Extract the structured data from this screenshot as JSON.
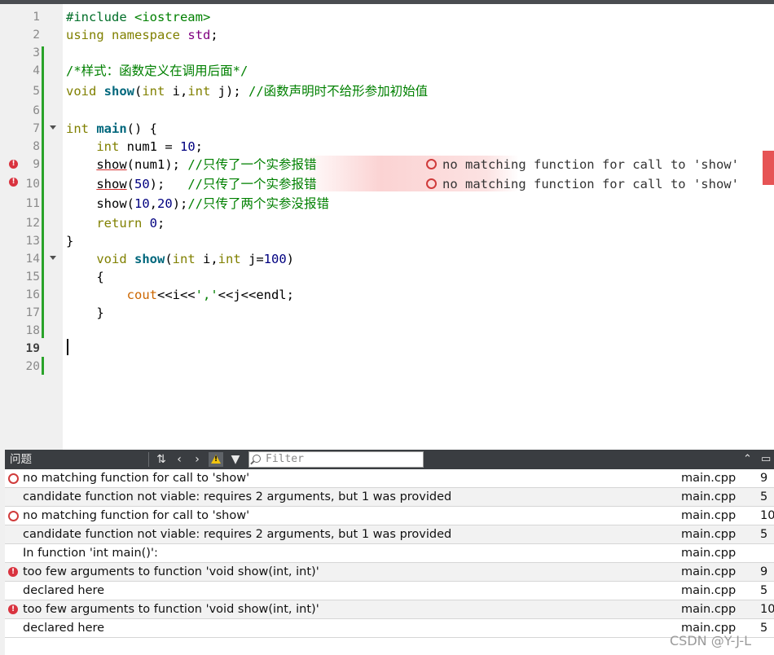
{
  "editor": {
    "line_numbers": [
      "1",
      "2",
      "3",
      "4",
      "5",
      "6",
      "7",
      "8",
      "9",
      "10",
      "11",
      "12",
      "13",
      "14",
      "15",
      "16",
      "17",
      "18",
      "19",
      "20"
    ],
    "current_line": "19",
    "lines": {
      "l1a": "#include",
      "l1b": " <iostream>",
      "l2a": "using",
      "l2b": "namespace",
      "l2c": "std",
      "l4": "/*样式：函数定义在调用后面*/",
      "l5a": "void",
      "l5b": "show",
      "l5c": "(",
      "l5d": "int",
      "l5e": " i,",
      "l5f": "int",
      "l5g": " j); ",
      "l5h": "//函数声明时不给形参加初始值",
      "l7a": "int",
      "l7b": "main",
      "l7c": "() {",
      "l8a": "int",
      "l8b": " num1 = ",
      "l8c": "10",
      "l8d": ";",
      "l9a": "show",
      "l9b": "(num1); ",
      "l9c": "//只传了一个实参报错",
      "l10a": "show",
      "l10b": "(",
      "l10c": "50",
      "l10d": ");   ",
      "l10e": "//只传了一个实参报错",
      "l11a": "show",
      "l11b": "(",
      "l11c": "10",
      "l11d": ",",
      "l11e": "20",
      "l11f": ");",
      "l11g": "//只传了两个实参没报错",
      "l12a": "return",
      "l12b": " ",
      "l12c": "0",
      "l12d": ";",
      "l13": "}",
      "l14a": "void",
      "l14b": "show",
      "l14c": "(",
      "l14d": "int",
      "l14e": " i,",
      "l14f": "int",
      "l14g": " j=",
      "l14h": "100",
      "l14i": ")",
      "l15": "{",
      "l16a": "cout",
      "l16b": "<<i<<",
      "l16c": "','",
      "l16d": "<<j<<endl;",
      "l17": "}"
    },
    "inline_errors": {
      "line9": "no matching function for call to 'show'",
      "line10": "no matching function for call to 'show'"
    }
  },
  "panel": {
    "title": "问题",
    "filter_placeholder": "Filter",
    "icons": [
      "filter-sort-icon",
      "prev-arrow-icon",
      "next-arrow-icon",
      "warning-icon",
      "funnel-icon",
      "search-icon",
      "collapse-up-icon",
      "maximize-icon"
    ],
    "issues": [
      {
        "type": "error-ring",
        "message": "no matching function for call to 'show'",
        "file": "main.cpp",
        "line": "9"
      },
      {
        "type": "none",
        "message": "candidate function not viable: requires 2 arguments, but 1 was provided",
        "file": "main.cpp",
        "line": "5"
      },
      {
        "type": "error-ring",
        "message": "no matching function for call to 'show'",
        "file": "main.cpp",
        "line": "10"
      },
      {
        "type": "none",
        "message": "candidate function not viable: requires 2 arguments, but 1 was provided",
        "file": "main.cpp",
        "line": "5"
      },
      {
        "type": "none",
        "message": "In function 'int main()':",
        "file": "main.cpp",
        "line": ""
      },
      {
        "type": "error",
        "message": "too few arguments to function 'void show(int, int)'",
        "file": "main.cpp",
        "line": "9"
      },
      {
        "type": "none",
        "message": "declared here",
        "file": "main.cpp",
        "line": "5"
      },
      {
        "type": "error",
        "message": "too few arguments to function 'void show(int, int)'",
        "file": "main.cpp",
        "line": "10"
      },
      {
        "type": "none",
        "message": "declared here",
        "file": "main.cpp",
        "line": "5"
      }
    ]
  },
  "watermark": "CSDN @Y-J-L",
  "colors": {
    "error": "#d9333f",
    "keyword": "#808000",
    "comment": "#008000",
    "function": "#00677c",
    "namespace": "#800080",
    "number": "#000080",
    "panel_header": "#3a3d41"
  }
}
